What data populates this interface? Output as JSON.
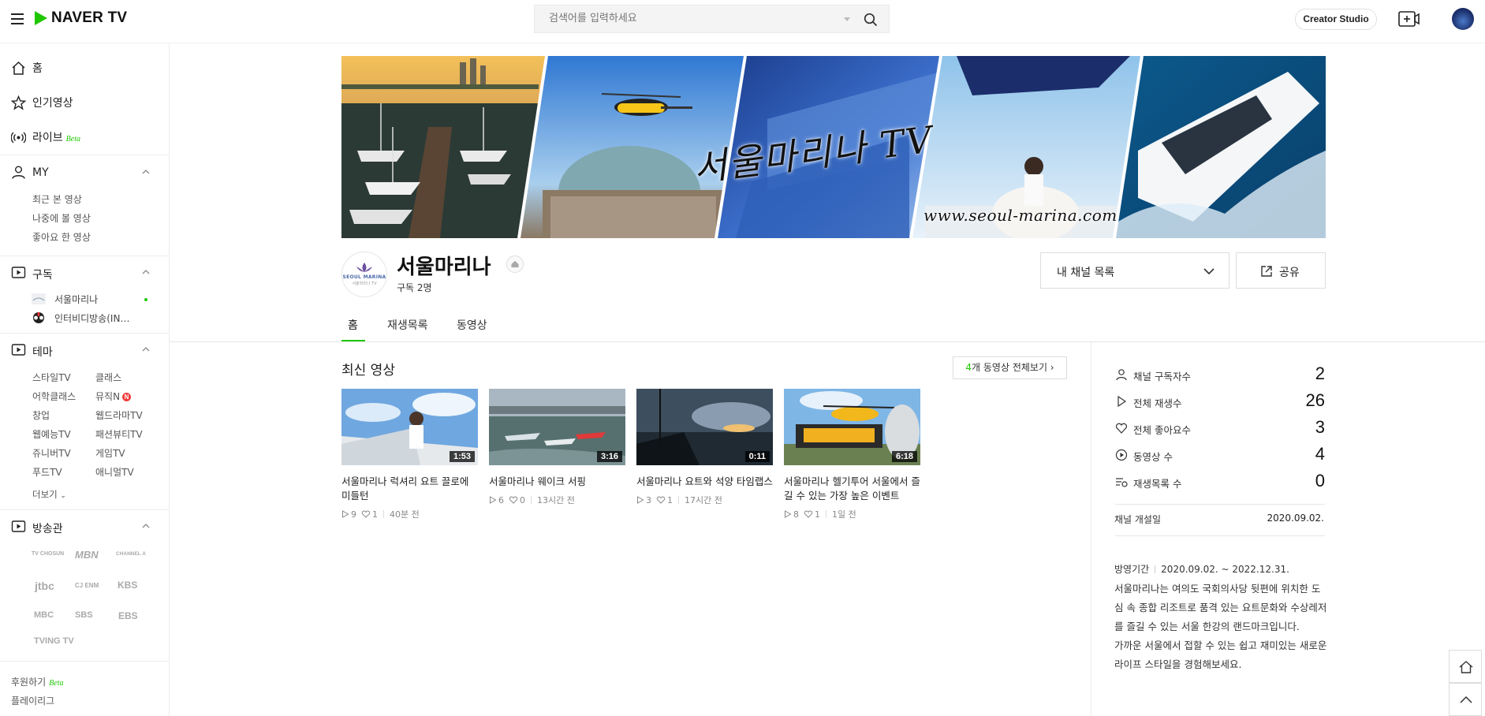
{
  "header": {
    "logo_text": "NAVER TV",
    "search_placeholder": "검색어를 입력하세요",
    "creator_studio": "Creator Studio"
  },
  "sidebar": {
    "home": "홈",
    "popular": "인기영상",
    "live": "라이브",
    "beta": "Beta",
    "my": {
      "label": "MY",
      "items": [
        "최근 본 영상",
        "나중에 볼 영상",
        "좋아요 한 영상"
      ]
    },
    "subscriptions": {
      "label": "구독",
      "items": [
        "서울마리나",
        "인터비디방송(IN…"
      ]
    },
    "theme": {
      "label": "테마",
      "items": [
        "스타일TV",
        "클래스",
        "어학클래스",
        "뮤직N",
        "창업",
        "웹드라마TV",
        "웹예능TV",
        "패션뷰티TV",
        "쥬니버TV",
        "게임TV",
        "푸드TV",
        "애니멀TV"
      ],
      "more": "더보기",
      "n_badge": "N"
    },
    "broadcasters": {
      "label": "방송관",
      "items": [
        "TV CHOSUN",
        "MBN",
        "CHANNEL A",
        "jtbc",
        "CJ ENM",
        "KBS",
        "MBC",
        "SBS",
        "EBS",
        "TVING TV"
      ]
    },
    "footer": {
      "donate": "후원하기",
      "playleague": "플레이리그"
    }
  },
  "banner": {
    "title": "서울마리나 TV",
    "url": "www.seoul-marina.com"
  },
  "channel": {
    "logo_line1": "SEOUL MARINA",
    "logo_line2": "서울마리나 TV",
    "name": "서울마리나",
    "subscribers_text": "구독 2명",
    "my_channels": "내 채널 목록",
    "share": "공유"
  },
  "tabs": [
    "홈",
    "재생목록",
    "동영상"
  ],
  "latest": {
    "title": "최신 영상",
    "all_count": "4",
    "all_label": "개 동영상 전체보기",
    "videos": [
      {
        "duration": "1:53",
        "title": "서울마리나 럭셔리 요트 끌로에 미들턴",
        "plays": "9",
        "likes": "1",
        "time": "40분 전"
      },
      {
        "duration": "3:16",
        "title": "서울마리나 웨이크 서핑",
        "plays": "6",
        "likes": "0",
        "time": "13시간 전"
      },
      {
        "duration": "0:11",
        "title": "서울마리나 요트와 석양 타임랩스",
        "plays": "3",
        "likes": "1",
        "time": "17시간 전"
      },
      {
        "duration": "6:18",
        "title": "서울마리나 헬기투어 서울에서 즐길 수 있는 가장 높은 이벤트",
        "plays": "8",
        "likes": "1",
        "time": "1일 전"
      }
    ]
  },
  "stats": {
    "rows": [
      {
        "label": "채널 구독자수",
        "value": "2"
      },
      {
        "label": "전체 재생수",
        "value": "26"
      },
      {
        "label": "전체 좋아요수",
        "value": "3"
      },
      {
        "label": "동영상 수",
        "value": "4"
      },
      {
        "label": "재생목록 수",
        "value": "0"
      }
    ],
    "opened_label": "채널 개설일",
    "opened_value": "2020.09.02.",
    "period_label": "방영기간",
    "period_value": "2020.09.02. ~ 2022.12.31.",
    "desc1": "서울마리나는 여의도 국회의사당 뒷편에 위치한 도심 속 종합 리조트로 품격 있는 요트문화와 수상레저를 즐길 수 있는 서울 한강의 랜드마크입니다.",
    "desc2": "가까운 서울에서 접할 수 있는 쉽고 재미있는 새로운 라이프 스타일을 경험해보세요."
  },
  "colors": {
    "accent": "#1ec800",
    "badge_red": "#f13c3c"
  }
}
